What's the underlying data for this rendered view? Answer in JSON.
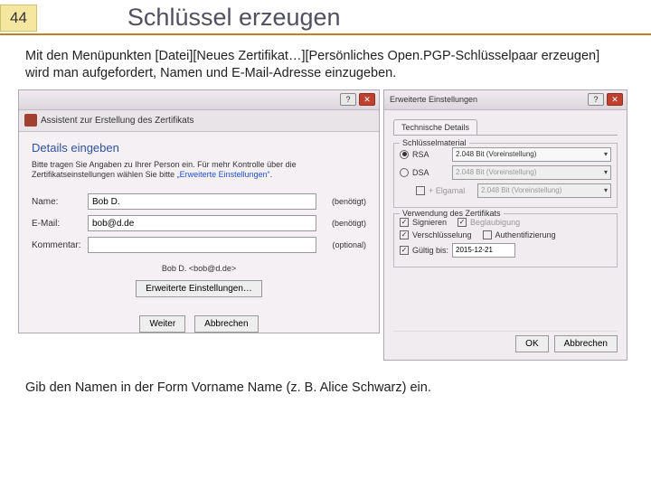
{
  "page_number": "44",
  "title": "Schlüssel erzeugen",
  "intro": "Mit den Menüpunkten [Datei][Neues Zertifikat…][Persönliches Open.PGP-Schlüsselpaar erzeugen] wird man aufgefordert, Namen und E-Mail-Adresse einzugeben.",
  "footer": "Gib den Namen in der Form Vorname Name (z. B. Alice Schwarz) ein.",
  "win1": {
    "toolbar_title": "Assistent zur Erstellung des Zertifikats",
    "heading": "Details eingeben",
    "desc_pre": "Bitte tragen Sie Angaben zu Ihrer Person ein. Für mehr Kontrolle über die Zertifikatseinstellungen wählen Sie bitte ",
    "desc_link": "„Erweiterte Einstellungen“",
    "desc_post": ".",
    "name_label": "Name:",
    "name_value": "Bob D.",
    "name_req": "(benötigt)",
    "email_label": "E-Mail:",
    "email_value": "bob@d.de",
    "email_req": "(benötigt)",
    "comment_label": "Kommentar:",
    "comment_value": "",
    "comment_req": "(optional)",
    "id_line": "Bob D. <bob@d.de>",
    "adv_btn": "Erweiterte Einstellungen…",
    "next": "Weiter",
    "cancel": "Abbrechen"
  },
  "win2": {
    "title": "Erweiterte Einstellungen",
    "tab": "Technische Details",
    "group1": "Schlüsselmaterial",
    "rsa": "RSA",
    "rsa_bits": "2.048 Bit (Voreinstellung)",
    "dsa": "DSA",
    "dsa_bits": "2.048 Bit (Voreinstellung)",
    "elgamal": "+ Elgamal",
    "elgamal_bits": "2.048 Bit (Voreinstellung)",
    "group2": "Verwendung des Zertifikats",
    "sign": "Signieren",
    "cert": "Beglaubigung",
    "encrypt": "Verschlüsselung",
    "auth": "Authentifizierung",
    "valid": "Gültig bis:",
    "valid_date": "2015-12-21",
    "ok": "OK",
    "cancel": "Abbrechen"
  }
}
